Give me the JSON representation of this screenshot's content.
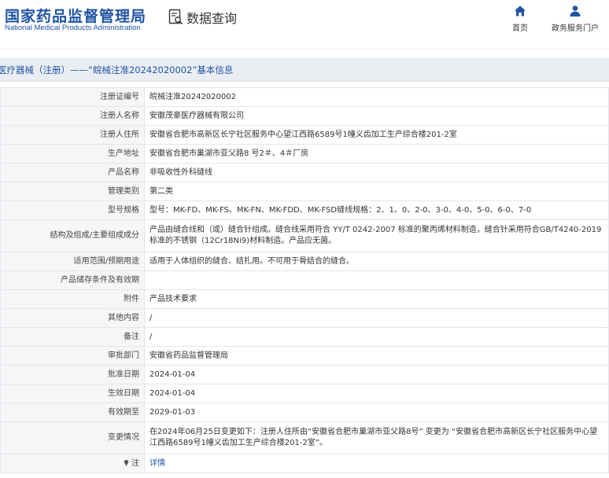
{
  "header": {
    "logo_cn": "国家药品监督管理局",
    "logo_en": "National Medical Products Administration",
    "query_label": "数据查询",
    "nav": [
      {
        "label": "首页",
        "icon": "home-icon"
      },
      {
        "label": "政务服务门户",
        "icon": "user-icon"
      }
    ]
  },
  "page_title": "医疗器械（注册）——“皖械注准20242020002”基本信息",
  "rows": [
    {
      "label": "注册证编号",
      "value": "皖械注准20242020002"
    },
    {
      "label": "注册人名称",
      "value": "安徽茂豪医疗器械有限公司"
    },
    {
      "label": "注册人住所",
      "value": "安徽省合肥市高新区长宁社区服务中心望江西路6589号1幢义齿加工生产综合楼201-2室"
    },
    {
      "label": "生产地址",
      "value": "安徽省合肥市巢湖市亚父路8 号2＃、4＃厂房"
    },
    {
      "label": "产品名称",
      "value": "非吸收性外科缝线"
    },
    {
      "label": "管理类别",
      "value": "第二类"
    },
    {
      "label": "型号规格",
      "value": "型号：MK-FD、MK-FS、MK-FN、MK-FDD、MK-FSD缝线规格：2、1、0、2-0、3-0、4-0、5-0、6-0、7-0"
    },
    {
      "label": "结构及组成/主要组成成分",
      "value": "产品由缝合线和（或）缝合针组成。缝合线采用符合 YY/T 0242-2007 标准的聚丙烯材料制造，缝合针采用符合GB/T4240-2019 标准的不锈钢（12Cr18Ni9)材料制造。产品应无菌。"
    },
    {
      "label": "适用范围/预期用途",
      "value": "适用于人体组织的缝合、结扎用。不可用于骨结合的缝合。"
    },
    {
      "label": "产品储存条件及有效期",
      "value": ""
    },
    {
      "label": "附件",
      "value": "产品技术要求"
    },
    {
      "label": "其他内容",
      "value": "/"
    },
    {
      "label": "备注",
      "value": "/"
    },
    {
      "label": "审批部门",
      "value": "安徽省药品监督管理局"
    },
    {
      "label": "批准日期",
      "value": "2024-01-04"
    },
    {
      "label": "生效日期",
      "value": "2024-01-04"
    },
    {
      "label": "有效期至",
      "value": "2029-01-03"
    },
    {
      "label": "变更情况",
      "value": "在2024年06月25日变更如下：注册人住所由“安徽省合肥市巢湖市亚父路8号” 变更为 “安徽省合肥市高新区长宁社区服务中心望江西路6589号1幢义齿加工生产综合楼201-2室”。"
    }
  ],
  "note_row": {
    "label": "注",
    "icon": "pin-icon",
    "link": "详情"
  }
}
